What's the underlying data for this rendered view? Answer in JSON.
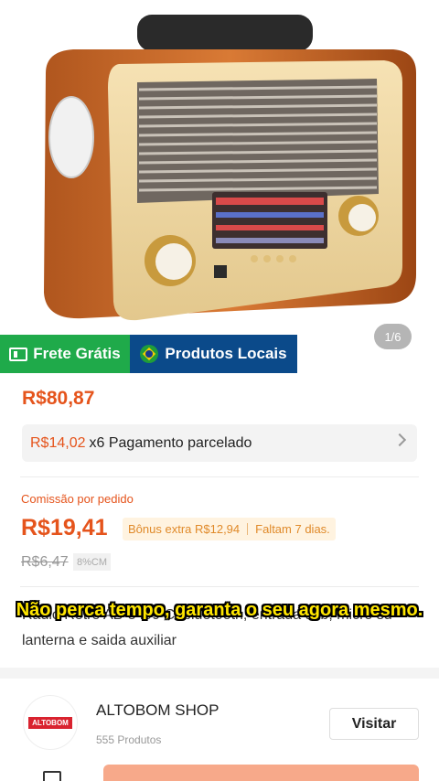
{
  "gallery": {
    "pager": "1/6"
  },
  "badges": {
    "free_shipping": "Frete Grátis",
    "local_products": "Produtos Locais"
  },
  "product": {
    "price": "R$80,87",
    "installment": {
      "amount": "R$14,02",
      "text": "x6 Pagamento parcelado"
    },
    "commission": {
      "label": "Comissão por pedido",
      "value": "R$19,41",
      "bonus": "Bônus extra R$12,94",
      "remaining": "Faltam 7 dias."
    },
    "old_commission": "R$6,47",
    "rate": "8%CM",
    "title": "Radio Retro AB-8499 C/ bluetooth, entrada usb, micro sd lanterna e saida auxiliar"
  },
  "caption": "Não perca tempo, garanta o seu agora mesmo.",
  "shop": {
    "logo_text": "ALTOBOM",
    "name": "ALTOBOM SHOP",
    "products": "555 Produtos",
    "visit_label": "Visitar"
  },
  "colors": {
    "accent": "#e5541c",
    "free_shipping": "#1faa4a",
    "local": "#0b4a8a",
    "subtitle": "#ffe600"
  },
  "icons": [
    "truck-icon",
    "brazil-flag-icon",
    "chevron-right-icon",
    "chat-icon"
  ]
}
